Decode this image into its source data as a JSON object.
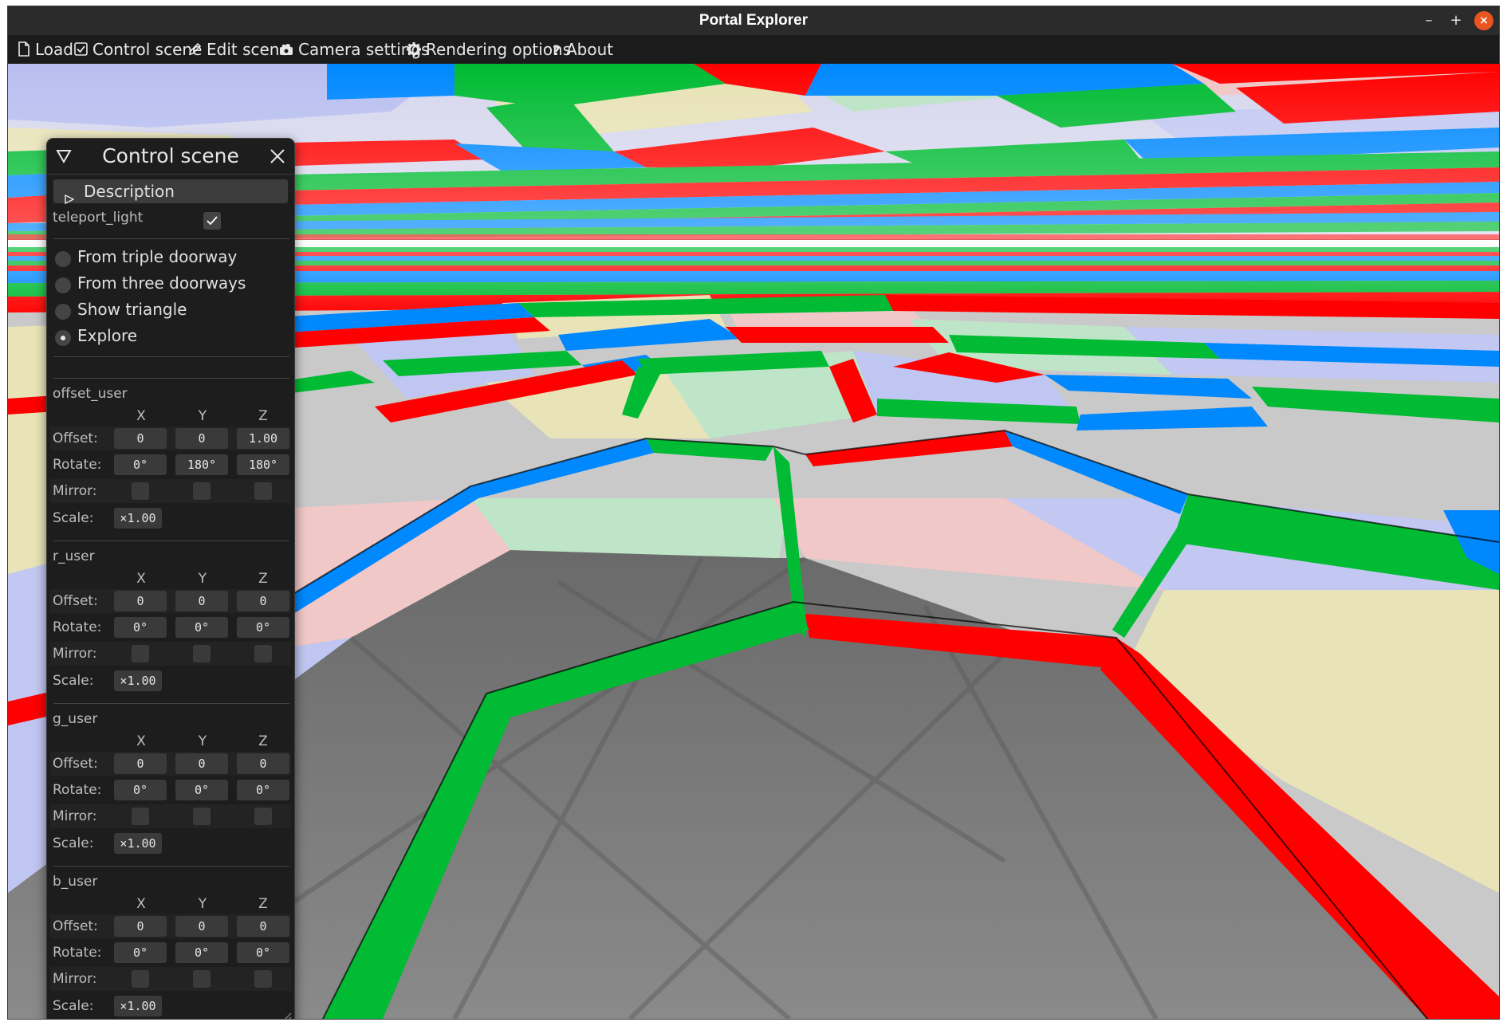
{
  "window": {
    "title": "Portal Explorer",
    "controls": {
      "minimize": "–",
      "maximize": "+",
      "close": "×"
    }
  },
  "menu": [
    {
      "label": "Load",
      "icon": "file-icon"
    },
    {
      "label": "Control scene",
      "icon": "checkbox-icon"
    },
    {
      "label": "Edit scene",
      "icon": "pencil-icon"
    },
    {
      "label": "Camera settings",
      "icon": "camera-icon"
    },
    {
      "label": "Rendering options",
      "icon": "gear-icon"
    },
    {
      "label": "About",
      "icon": "question-icon"
    }
  ],
  "panel": {
    "title": "Control scene",
    "description_label": "Description",
    "teleport_light": {
      "label": "teleport_light",
      "checked": true
    },
    "modes": [
      {
        "label": "From triple doorway",
        "selected": false
      },
      {
        "label": "From three doorways",
        "selected": false
      },
      {
        "label": "Show triangle",
        "selected": false
      },
      {
        "label": "Explore",
        "selected": true
      }
    ],
    "axes": [
      "X",
      "Y",
      "Z"
    ],
    "row_labels": {
      "offset": "Offset:",
      "rotate": "Rotate:",
      "mirror": "Mirror:",
      "scale": "Scale:"
    },
    "groups": [
      {
        "name": "offset_user",
        "offset": [
          "0",
          "0",
          "1.00"
        ],
        "rotate": [
          "0°",
          "180°",
          "180°"
        ],
        "mirror": [
          false,
          false,
          false
        ],
        "scale": "×1.00"
      },
      {
        "name": "r_user",
        "offset": [
          "0",
          "0",
          "0"
        ],
        "rotate": [
          "0°",
          "0°",
          "0°"
        ],
        "mirror": [
          false,
          false,
          false
        ],
        "scale": "×1.00"
      },
      {
        "name": "g_user",
        "offset": [
          "0",
          "0",
          "0"
        ],
        "rotate": [
          "0°",
          "0°",
          "0°"
        ],
        "mirror": [
          false,
          false,
          false
        ],
        "scale": "×1.00"
      },
      {
        "name": "b_user",
        "offset": [
          "0",
          "0",
          "0"
        ],
        "rotate": [
          "0°",
          "0°",
          "0°"
        ],
        "mirror": [
          false,
          false,
          false
        ],
        "scale": "×1.00"
      }
    ]
  },
  "scene_colors": {
    "red": "#ff0000",
    "green": "#00bb33",
    "blue": "#0088ff",
    "floor": "#808080"
  }
}
